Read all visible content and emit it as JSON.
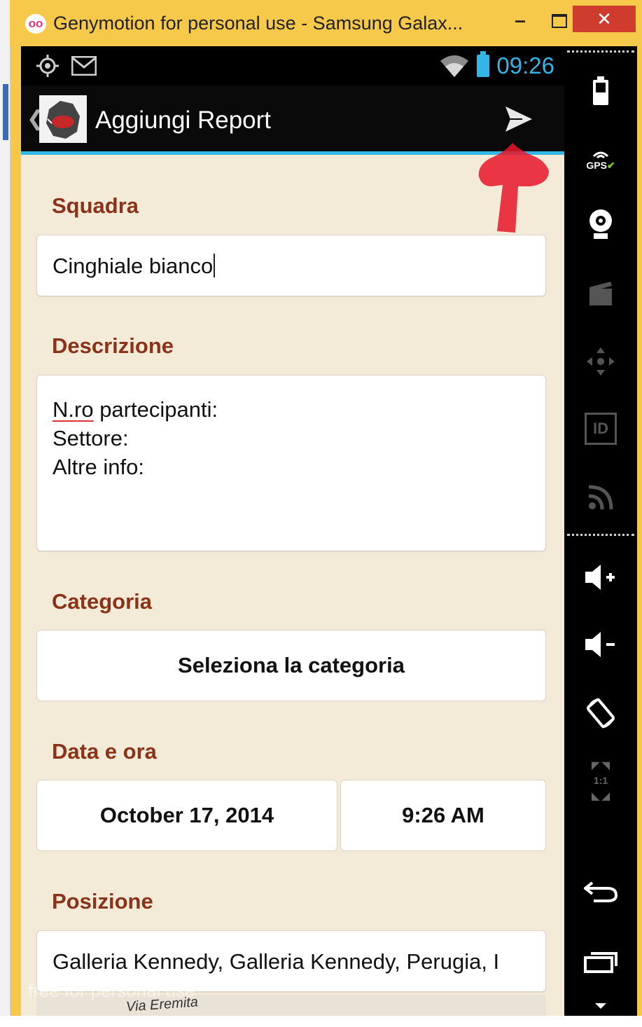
{
  "window": {
    "title": "Genymotion for personal use - Samsung Galax...",
    "app_icon": "oo",
    "minimize_label": "–",
    "close_label": "✕"
  },
  "statusbar": {
    "time": "09:26",
    "left_icons": [
      "gps-icon",
      "gmail-icon"
    ],
    "right_icons": [
      "wifi-icon",
      "battery-icon"
    ],
    "accent_color": "#33b5e5"
  },
  "actionbar": {
    "back_glyph": "❮",
    "title": "Aggiungi Report",
    "send_icon": "send-icon"
  },
  "form": {
    "squadra_label": "Squadra",
    "squadra_value": "Cinghiale bianco",
    "descrizione_label": "Descrizione",
    "descrizione_lines": {
      "line1_spell": "N.ro",
      "line1_rest": " partecipanti:",
      "line2": "Settore:",
      "line3": "Altre info:"
    },
    "categoria_label": "Categoria",
    "categoria_button": "Seleziona la categoria",
    "data_label": "Data e ora",
    "date_button": "October 17, 2014",
    "time_button": "9:26 AM",
    "posizione_label": "Posizione",
    "posizione_value": "Galleria Kennedy, Galleria Kennedy, Perugia, I",
    "map_label": "Via Eremita",
    "label_color": "#8b3318",
    "background_color": "#f3ead8"
  },
  "watermark": "free for personal use",
  "sidepanel": {
    "icons": [
      "battery-widget-icon",
      "gps-widget-icon",
      "webcam-icon",
      "capture-icon",
      "dpad-icon",
      "id-icon",
      "rss-icon",
      "volume-up-icon",
      "volume-down-icon",
      "rotate-icon",
      "pixel-perfect-icon",
      "back-icon",
      "recent-apps-icon"
    ],
    "gps_label": "GPS",
    "id_label": "ID",
    "pixel_label": "1:1"
  }
}
